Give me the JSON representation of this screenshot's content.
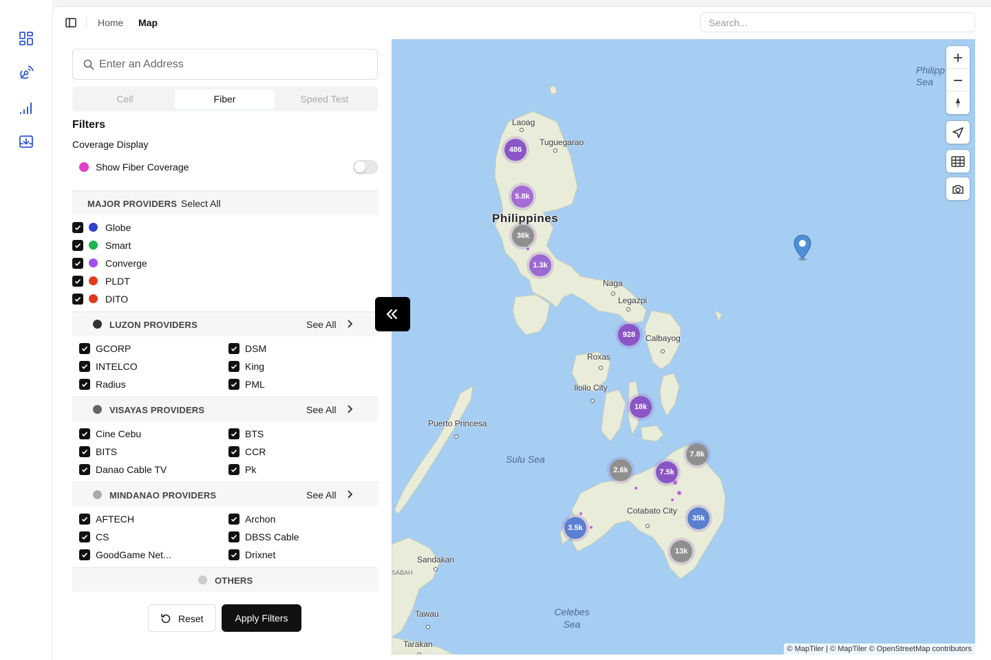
{
  "header": {
    "breadcrumb_home": "Home",
    "breadcrumb_current": "Map",
    "search_placeholder": "Search..."
  },
  "sidebar_icons": [
    "dashboard-icon",
    "signal-tower-icon",
    "signal-bars-icon",
    "download-tray-icon"
  ],
  "panel": {
    "address_placeholder": "Enter an Address",
    "tabs": [
      {
        "label": "Cell",
        "active": false
      },
      {
        "label": "Fiber",
        "active": true
      },
      {
        "label": "Speed Test",
        "active": false
      }
    ],
    "filters_title": "Filters",
    "coverage_display_label": "Coverage Display",
    "show_fiber_coverage": {
      "label": "Show Fiber Coverage",
      "enabled": false,
      "color": "#e040c8"
    },
    "major": {
      "title": "MAJOR PROVIDERS",
      "select_all": "Select All",
      "items": [
        {
          "label": "Globe",
          "color": "#2f3fcf",
          "checked": true
        },
        {
          "label": "Smart",
          "color": "#19b34f",
          "checked": true
        },
        {
          "label": "Converge",
          "color": "#a24ef0",
          "checked": true
        },
        {
          "label": "PLDT",
          "color": "#e03a1e",
          "checked": true
        },
        {
          "label": "DITO",
          "color": "#e03a1e",
          "checked": true
        }
      ]
    },
    "luzon": {
      "title": "LUZON PROVIDERS",
      "see_all": "See All",
      "dot_color": "#333333",
      "items": [
        {
          "label": "GCORP",
          "checked": true
        },
        {
          "label": "DSM",
          "checked": true
        },
        {
          "label": "INTELCO",
          "checked": true
        },
        {
          "label": "King",
          "checked": true
        },
        {
          "label": "Radius",
          "checked": true
        },
        {
          "label": "PML",
          "checked": true
        }
      ]
    },
    "visayas": {
      "title": "VISAYAS PROVIDERS",
      "see_all": "See All",
      "dot_color": "#666666",
      "items": [
        {
          "label": "Cine Cebu",
          "checked": true
        },
        {
          "label": "BTS",
          "checked": true
        },
        {
          "label": "BITS",
          "checked": true
        },
        {
          "label": "CCR",
          "checked": true
        },
        {
          "label": "Danao Cable TV",
          "checked": true
        },
        {
          "label": "Pk",
          "checked": true
        }
      ]
    },
    "mindanao": {
      "title": "MINDANAO PROVIDERS",
      "see_all": "See All",
      "dot_color": "#aaaaaa",
      "items": [
        {
          "label": "AFTECH",
          "checked": true
        },
        {
          "label": "Archon",
          "checked": true
        },
        {
          "label": "CS",
          "checked": true
        },
        {
          "label": "DBSS Cable",
          "checked": true
        },
        {
          "label": "GoodGame Net...",
          "checked": true
        },
        {
          "label": "Drixnet",
          "checked": true
        }
      ]
    },
    "others": {
      "title": "OTHERS",
      "dot_color": "#cccccc"
    },
    "reset_label": "Reset",
    "apply_label": "Apply Filters"
  },
  "map": {
    "country_label": "Philippines",
    "places": [
      "Laoag",
      "Tuguegarao",
      "Naga",
      "Legazpi",
      "Calbayog",
      "Roxas",
      "Iloilo City",
      "Puerto Princesa",
      "Cotabato City",
      "Sandakan",
      "Tawau",
      "Tarakan",
      "SABAH"
    ],
    "seas": [
      "Sulu Sea",
      "Celebes Sea",
      "Philipp Sea"
    ],
    "clusters": [
      "486",
      "5.8k",
      "36k",
      "1.3k",
      "928",
      "18k",
      "2.6k",
      "7.5k",
      "7.8k",
      "35k",
      "3.5k",
      "13k"
    ],
    "cluster_colors": {
      "purple": "#8a56c7",
      "gray": "#8f8f8f",
      "blue": "#5b7fd1"
    },
    "controls": [
      "zoom-in-icon",
      "zoom-out-icon",
      "compass-icon",
      "locate-icon",
      "grid-icon",
      "camera-icon"
    ],
    "attribution": "© MapTiler | © MapTiler © OpenStreetMap contributors",
    "water_color": "#a6cdf2",
    "land_color": "#e9ecd9"
  }
}
